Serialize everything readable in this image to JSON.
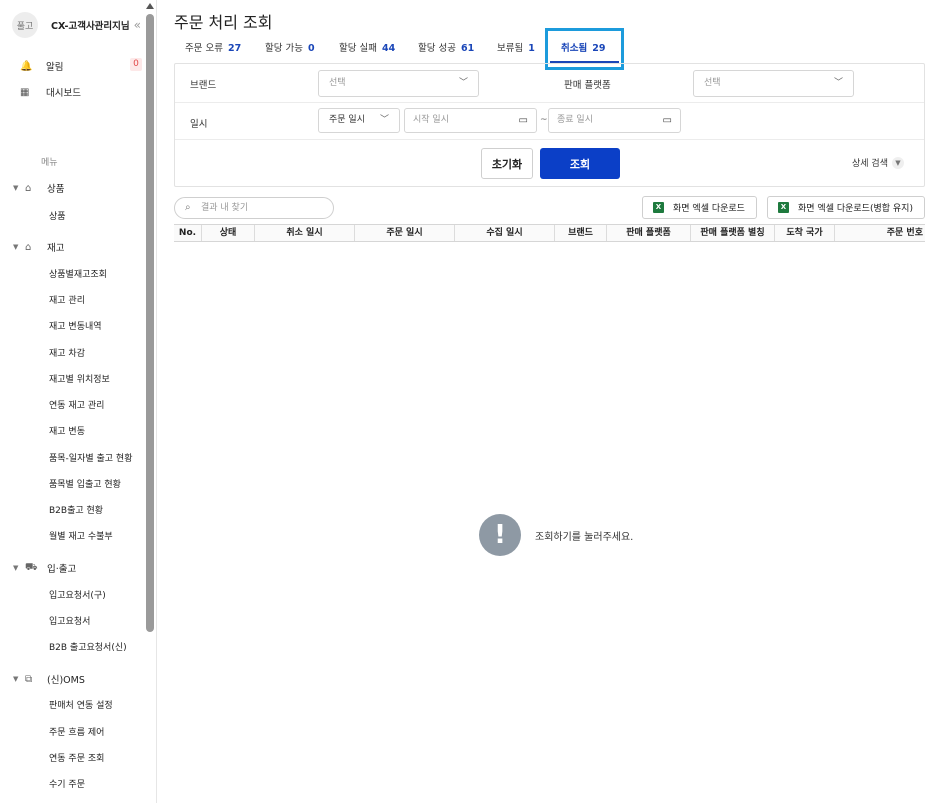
{
  "sidebar": {
    "tenant_avatar": "풀고",
    "tenant_name": "CX-고객사관리지님",
    "collapse_icon": "«",
    "notice_label": "알림",
    "notice_count": "0",
    "dashboard_label": "대시보드",
    "menu_header": "메뉴",
    "groups": {
      "product": {
        "label": "상품",
        "items": [
          "상품"
        ]
      },
      "stock": {
        "label": "재고",
        "items": [
          "상품별재고조회",
          "재고 관리",
          "재고 변동내역",
          "재고 차감",
          "재고별 위치정보",
          "연동 재고 관리",
          "재고 변동",
          "품목-일자별 출고 현황",
          "품목별 입출고 현황",
          "B2B출고 현황",
          "월별 재고 수불부"
        ]
      },
      "inout": {
        "label": "입·출고",
        "items": [
          "입고요청서(구)",
          "입고요청서",
          "B2B 출고요청서(신)"
        ]
      },
      "oms": {
        "label": "(신)OMS",
        "items": [
          "판매처 연동 설정",
          "주문 흐름 제어",
          "연동 주문 조회",
          "수기 주문"
        ]
      }
    }
  },
  "main": {
    "title": "주문 처리 조회",
    "tabs": [
      {
        "label": "주문 오류",
        "count": "27"
      },
      {
        "label": "할당 가능",
        "count": "0"
      },
      {
        "label": "할당 실패",
        "count": "44"
      },
      {
        "label": "할당 성공",
        "count": "61"
      },
      {
        "label": "보류됨",
        "count": "1"
      },
      {
        "label": "취소됨",
        "count": "29"
      }
    ],
    "filter": {
      "brand_label": "브랜드",
      "brand_placeholder": "선택",
      "platform_label": "판매 플랫폼",
      "platform_placeholder": "선택",
      "date_label": "일시",
      "date_type": "주문 일시",
      "start_placeholder": "시작 일시",
      "tilde": "~",
      "end_placeholder": "종료 일시",
      "reset_label": "초기화",
      "search_label": "조회",
      "advanced_label": "상세 검색"
    },
    "result_search_placeholder": "결과 내 찾기",
    "download_label": "화면 엑셀 다운로드",
    "download_merged_label": "화면 엑셀 다운로드(병합 유지)",
    "columns": [
      "No.",
      "상태",
      "취소 일시",
      "주문 일시",
      "수집 일시",
      "브랜드",
      "판매 플랫폼",
      "판매 플랫폼 별칭",
      "도착 국가",
      "주문 번호"
    ],
    "empty_message": "조회하기를 눌러주세요."
  }
}
